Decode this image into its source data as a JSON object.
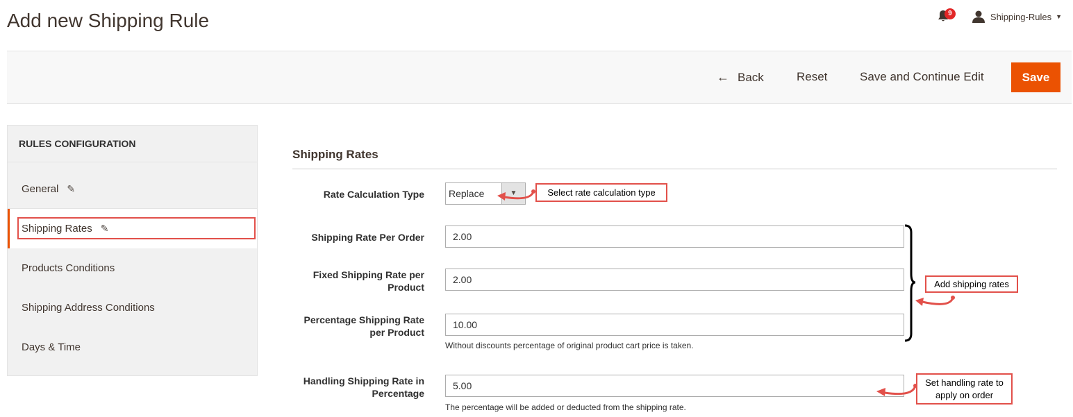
{
  "header": {
    "title": "Add new Shipping Rule",
    "notifications_count": "9",
    "user_name": "Shipping-Rules"
  },
  "toolbar": {
    "back_label": "Back",
    "reset_label": "Reset",
    "save_edit_label": "Save and Continue Edit",
    "save_label": "Save"
  },
  "sidebar": {
    "title": "RULES CONFIGURATION",
    "items": [
      {
        "label": "General"
      },
      {
        "label": "Shipping Rates"
      },
      {
        "label": "Products Conditions"
      },
      {
        "label": "Shipping Address Conditions"
      },
      {
        "label": "Days & Time"
      }
    ]
  },
  "section": {
    "title": "Shipping Rates"
  },
  "form": {
    "rate_calc": {
      "label": "Rate Calculation Type",
      "value": "Replace"
    },
    "per_order": {
      "label": "Shipping Rate Per Order",
      "value": "2.00"
    },
    "fixed_per_product": {
      "label_line1": "Fixed Shipping Rate per",
      "label_line2": "Product",
      "value": "2.00"
    },
    "percentage": {
      "label_line1": "Percentage Shipping Rate",
      "label_line2": "per Product",
      "value": "10.00",
      "note": "Without discounts percentage of original product cart price is taken."
    },
    "handling": {
      "label_line1": "Handling Shipping Rate in",
      "label_line2": "Percentage",
      "value": "5.00",
      "note": "The percentage will be added or deducted from the shipping rate."
    }
  },
  "annotations": {
    "select_type": "Select rate calculation type",
    "add_rates": "Add shipping rates",
    "handling_line1": "Set handling rate to",
    "handling_line2": "apply on order"
  },
  "colors": {
    "accent": "#eb5202",
    "annotation": "#e2504a"
  }
}
